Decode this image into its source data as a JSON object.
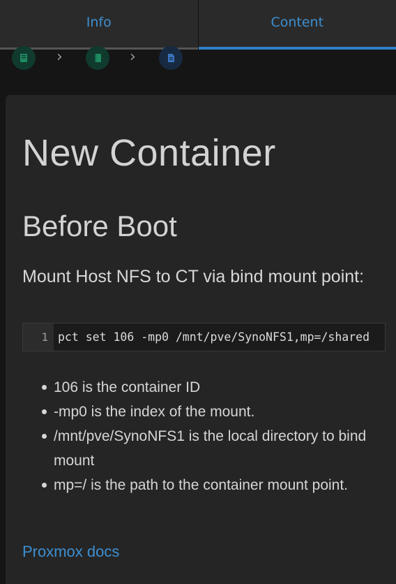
{
  "tabs": [
    {
      "label": "Info"
    },
    {
      "label": "Content",
      "active": true
    }
  ],
  "breadcrumbs": [
    {
      "icon": "book-icon",
      "color": "#1e7a57"
    },
    {
      "icon": "notebook-icon",
      "color": "#1e7a57"
    },
    {
      "icon": "document-icon",
      "color": "#3b6fb0"
    }
  ],
  "article": {
    "title": "New Container",
    "section": "Before Boot",
    "paragraph": "Mount Host NFS to CT via bind mount point:",
    "code": {
      "line_number": "1",
      "text": "pct set 106 -mp0 /mnt/pve/SynoNFS1,mp=/shared"
    },
    "bullets": [
      "106 is the container ID",
      "-mp0 is the index of the mount.",
      "/mnt/pve/SynoNFS1 is the local directory to bind mount",
      "mp=/ is the path to the container mount point."
    ],
    "link": "Proxmox docs"
  },
  "colors": {
    "accent": "#3d8fd1",
    "background": "#151515",
    "card": "#252525"
  }
}
